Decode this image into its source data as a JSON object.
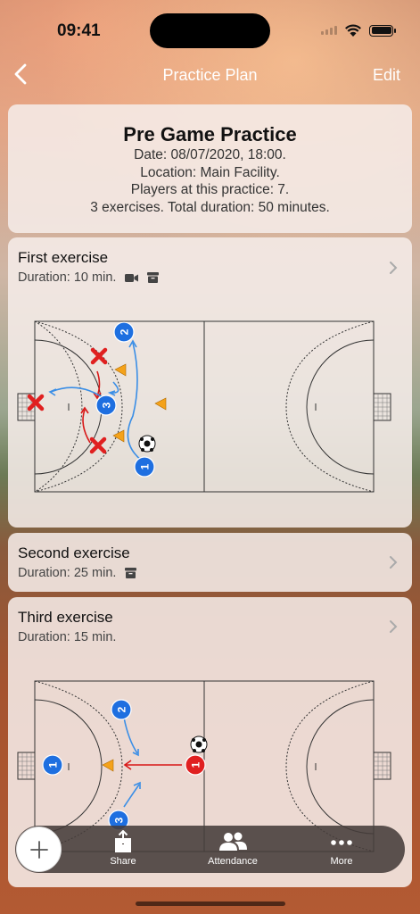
{
  "status_bar": {
    "time": "09:41"
  },
  "nav": {
    "title": "Practice Plan",
    "edit_label": "Edit",
    "back_icon": "chevron-left-icon"
  },
  "summary": {
    "title": "Pre Game Practice",
    "date": "Date: 08/07/2020, 18:00.",
    "location": "Location: Main Facility.",
    "players": "Players at this practice: 7.",
    "totals": "3 exercises. Total duration: 50 minutes."
  },
  "exercises": [
    {
      "title": "First exercise",
      "duration": "Duration: 10 min.",
      "icons": [
        "video-icon",
        "archive-icon"
      ]
    },
    {
      "title": "Second exercise",
      "duration": "Duration: 25 min.",
      "icons": [
        "archive-icon"
      ]
    },
    {
      "title": "Third exercise",
      "duration": "Duration: 15 min.",
      "icons": []
    }
  ],
  "court1_players": [
    {
      "num": "2"
    },
    {
      "num": "3"
    },
    {
      "num": "1"
    }
  ],
  "court3_players": [
    {
      "num": "2"
    },
    {
      "num": "1"
    },
    {
      "num": "3"
    },
    {
      "num": "1"
    }
  ],
  "tabbar": {
    "add_icon": "plus-icon",
    "tabs": [
      {
        "label": "Share",
        "icon": "share-icon"
      },
      {
        "label": "Attendance",
        "icon": "people-icon"
      },
      {
        "label": "More",
        "icon": "ellipsis-icon"
      }
    ]
  },
  "colors": {
    "blue_player": "#1e6fe0",
    "red_player": "#e02020",
    "arrow_red": "#d81818",
    "arrow_blue": "#3a8ee6",
    "cone": "#f4a21a"
  }
}
